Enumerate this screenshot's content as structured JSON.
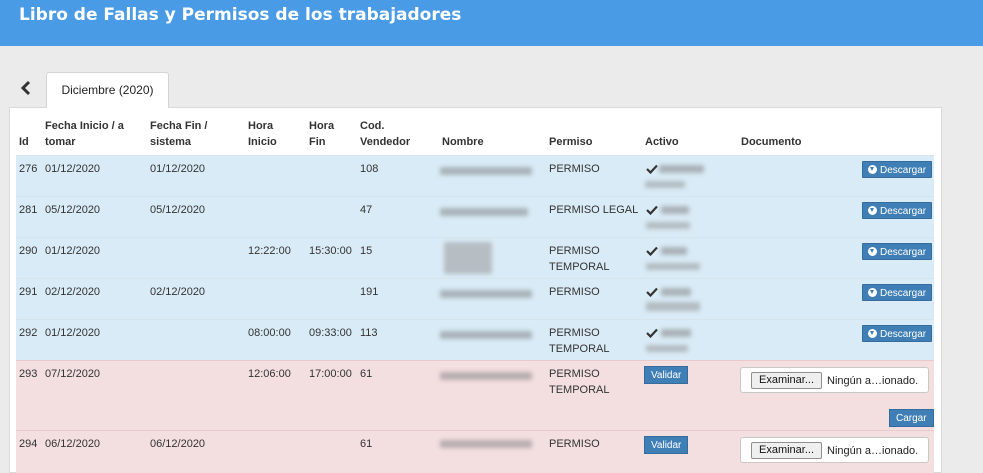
{
  "header": {
    "title": "Libro de Fallas y Permisos de los trabajadores"
  },
  "tab": {
    "label": "Diciembre (2020)"
  },
  "table": {
    "columns": {
      "id": "Id",
      "fecha_inicio": "Fecha Inicio / a tomar",
      "fecha_fin": "Fecha Fin / sistema",
      "hora_inicio": "Hora Inicio",
      "hora_fin": "Hora Fin",
      "cod_vendedor": "Cod. Vendedor",
      "nombre": "Nombre",
      "permiso": "Permiso",
      "activo": "Activo",
      "documento": "Documento"
    },
    "rows": [
      {
        "id": "276",
        "fecha_inicio": "01/12/2020",
        "fecha_fin": "01/12/2020",
        "hora_inicio": "",
        "hora_fin": "",
        "cod_vendedor": "108",
        "permiso": "PERMISO",
        "permiso_2": "",
        "activo": "check",
        "accion": "Descargar",
        "estado": "approved"
      },
      {
        "id": "281",
        "fecha_inicio": "05/12/2020",
        "fecha_fin": "05/12/2020",
        "hora_inicio": "",
        "hora_fin": "",
        "cod_vendedor": "47",
        "permiso": "PERMISO LEGAL",
        "permiso_2": "",
        "activo": "check",
        "accion": "Descargar",
        "estado": "approved"
      },
      {
        "id": "290",
        "fecha_inicio": "01/12/2020",
        "fecha_fin": "",
        "hora_inicio": "12:22:00",
        "hora_fin": "15:30:00",
        "cod_vendedor": "15",
        "permiso": "PERMISO",
        "permiso_2": "TEMPORAL",
        "activo": "check",
        "accion": "Descargar",
        "estado": "approved"
      },
      {
        "id": "291",
        "fecha_inicio": "02/12/2020",
        "fecha_fin": "02/12/2020",
        "hora_inicio": "",
        "hora_fin": "",
        "cod_vendedor": "191",
        "permiso": "PERMISO",
        "permiso_2": "",
        "activo": "check",
        "accion": "Descargar",
        "estado": "approved"
      },
      {
        "id": "292",
        "fecha_inicio": "01/12/2020",
        "fecha_fin": "",
        "hora_inicio": "08:00:00",
        "hora_fin": "09:33:00",
        "cod_vendedor": "113",
        "permiso": "PERMISO",
        "permiso_2": "TEMPORAL",
        "activo": "check",
        "accion": "Descargar",
        "estado": "approved"
      },
      {
        "id": "293",
        "fecha_inicio": "07/12/2020",
        "fecha_fin": "",
        "hora_inicio": "12:06:00",
        "hora_fin": "17:00:00",
        "cod_vendedor": "61",
        "permiso": "PERMISO",
        "permiso_2": "TEMPORAL",
        "validar": "Validar",
        "file_button": "Examinar...",
        "file_status": "Ningún a…ionado.",
        "upload": "Cargar",
        "estado": "pending"
      },
      {
        "id": "294",
        "fecha_inicio": "06/12/2020",
        "fecha_fin": "06/12/2020",
        "hora_inicio": "",
        "hora_fin": "",
        "cod_vendedor": "61",
        "permiso": "PERMISO",
        "permiso_2": "",
        "validar": "Validar",
        "file_button": "Examinar...",
        "file_status": "Ningún a…ionado.",
        "estado": "pending"
      }
    ]
  },
  "colors": {
    "header": "#4a9be6",
    "row_approved": "#d9ebf6",
    "row_pending": "#f3dfdf",
    "button": "#3f7fb5"
  },
  "icons": [
    "chevron-left-icon",
    "check-icon",
    "download-circle-icon"
  ]
}
